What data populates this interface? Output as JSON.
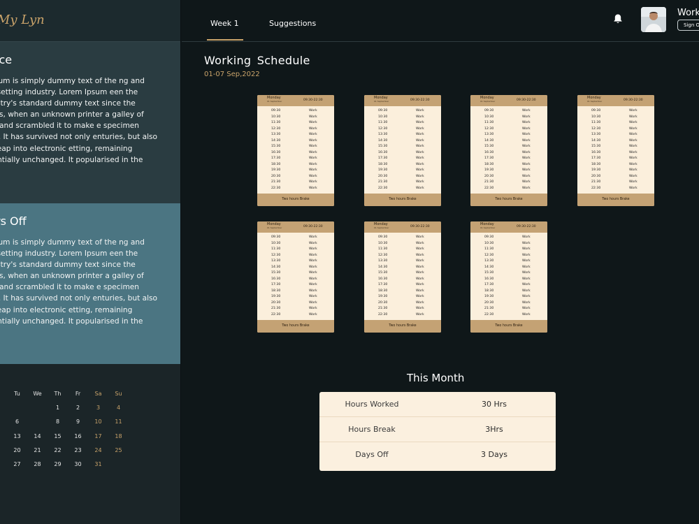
{
  "brand": {
    "name": "My Lyn"
  },
  "sidebar": {
    "notice": {
      "title": "ice",
      "body": "n Ipsum is simply dummy text of the ng and typesetting industry. Lorem Ipsum een the industry's standard dummy text since the 1500s, when an unknown printer a galley of type and scrambled it to make e specimen book. It has survived not only enturies, but also the leap into electronic etting, remaining essentially unchanged. It popularised in the"
    },
    "day_off": {
      "title": "rs Off",
      "body": "n Ipsum is simply dummy text of the ng and typesetting industry. Lorem Ipsum een the industry's standard dummy text since the 1500s, when an unknown printer a galley of type and scrambled it to make e specimen book. It has survived not only enturies, but also the leap into electronic etting, remaining essentially unchanged. It popularised in the"
    },
    "calendar": {
      "weekdays": [
        "",
        "Tu",
        "We",
        "Th",
        "Fr",
        "Sa",
        "Su"
      ],
      "weeks": [
        [
          "",
          "",
          "",
          "1",
          "2",
          "3",
          "4"
        ],
        [
          "",
          "6",
          "",
          "8",
          "9",
          "10",
          "11"
        ],
        [
          "",
          "13",
          "14",
          "15",
          "16",
          "17",
          "18"
        ],
        [
          "",
          "20",
          "21",
          "22",
          "23",
          "24",
          "25"
        ],
        [
          "",
          "27",
          "28",
          "29",
          "30",
          "31",
          ""
        ]
      ]
    }
  },
  "topbar": {
    "tabs": [
      "Week 1",
      "Suggestions"
    ],
    "bell_icon": "bell-icon",
    "user_name": "Work",
    "sign_out": "Sign Out"
  },
  "main": {
    "title": "Working  Schedule",
    "date_range": "01-07 Sep,2022"
  },
  "schedule": {
    "day": "Monday",
    "subtitle": "01 September",
    "hours": "09:30-22:30",
    "times": [
      "09:30",
      "10:30",
      "11:30",
      "12:30",
      "13:30",
      "14:30",
      "15:30",
      "16:30",
      "17:30",
      "18:30",
      "19:30",
      "20:30",
      "21:30",
      "22:30"
    ],
    "activity": "Work",
    "footer": "Two hours Brake",
    "card_count": 7
  },
  "month": {
    "title": "This Month",
    "rows": [
      {
        "label": "Hours Worked",
        "value": "30 Hrs"
      },
      {
        "label": "Hours Break",
        "value": "3Hrs"
      },
      {
        "label": "Days Off",
        "value": "3 Days"
      }
    ]
  },
  "colors": {
    "accent": "#c9a36a",
    "card_bg": "#fbefdc",
    "card_band": "#c4a274",
    "sidebar_teal": "#4b7582"
  }
}
